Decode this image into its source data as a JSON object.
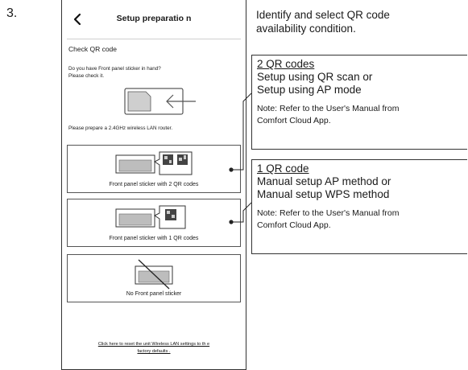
{
  "step": {
    "number": "3."
  },
  "app": {
    "header_title": "Setup preparatio n",
    "section_title": "Check QR code",
    "question_line1": "Do you have Front panel sticker in hand?",
    "question_line2": "Please check it.",
    "prepare_text": "Please prepare a 2.4GHz wireless LAN router.",
    "options": [
      {
        "label": "Front panel sticker with 2 QR codes",
        "qr_count": 2
      },
      {
        "label": "Front panel sticker with 1 QR codes",
        "qr_count": 1
      },
      {
        "label": "No Front panel sticker",
        "qr_count": 0
      }
    ],
    "reset_link_line1": "Click here to reset the unit Wireless LAN settings to th      e",
    "reset_link_line2": "factory defaults ."
  },
  "instruction": {
    "line1": "Identify and select QR code",
    "line2": "availability condition."
  },
  "boxes": [
    {
      "heading": "2 QR codes",
      "line1": "Setup using QR scan or",
      "line2": "Setup using AP mode",
      "note_line1": "Note: Refer to the User's Manual from",
      "note_line2": "Comfort Cloud App."
    },
    {
      "heading": "1 QR code",
      "line1": "Manual setup AP method or",
      "line2": "Manual setup WPS method",
      "note_line1": "Note: Refer to the User's Manual from",
      "note_line2": "Comfort Cloud App."
    }
  ]
}
